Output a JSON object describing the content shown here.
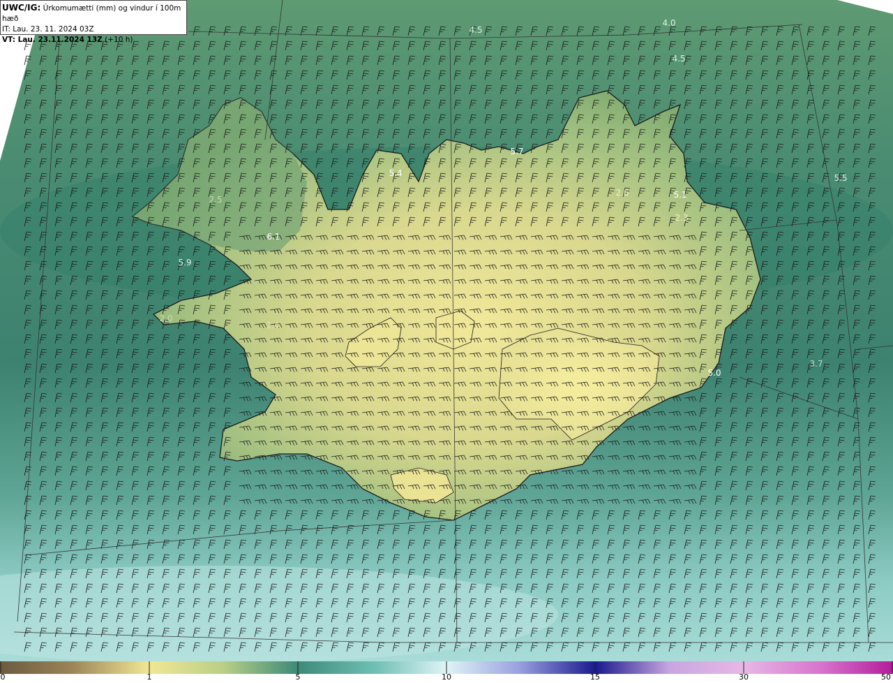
{
  "header": {
    "product": "UWC/IG:",
    "title": "Úrkomumætti (mm) og vindur í 100m hæð",
    "init_time": "IT: Lau. 23. 11. 2024 03Z",
    "valid_prefix": "VT: Lau. 23.11.2024 13Z",
    "valid_suffix": "(+10 h)"
  },
  "colors": {
    "field_sea_dark": "#3f7f6a",
    "field_sea_light": "#9fd6d0",
    "field_land_low": "#7ea86c",
    "field_land_high": "#efe79a",
    "coastline": "#1a1a1a",
    "grid_line": "#333333",
    "wind_barb": "#1a1a1a"
  },
  "map_labels": [
    {
      "text": "4.5",
      "color": "light"
    },
    {
      "text": "4.0",
      "color": "light"
    },
    {
      "text": "4.5",
      "color": "light"
    },
    {
      "text": "5.7",
      "color": "light"
    },
    {
      "text": "5.4",
      "color": "light"
    },
    {
      "text": "5.5",
      "color": "light"
    },
    {
      "text": "2.5",
      "color": "faint"
    },
    {
      "text": "2.6",
      "color": "faint"
    },
    {
      "text": "5.1",
      "color": "light"
    },
    {
      "text": "2.3",
      "color": "faint"
    },
    {
      "text": "6.1",
      "color": "light"
    },
    {
      "text": "5.9",
      "color": "light"
    },
    {
      "text": "2.0",
      "color": "faint"
    },
    {
      "text": "2.4",
      "color": "faint"
    },
    {
      "text": "5.0",
      "color": "light"
    },
    {
      "text": "3.7",
      "color": "faint"
    }
  ],
  "colorbar": {
    "ticks": [
      "0",
      "1",
      "5",
      "10",
      "15",
      "30",
      "50"
    ],
    "colors": [
      "#6b5a3e",
      "#b8a56a",
      "#f2e795",
      "#9fbf78",
      "#3d8a78",
      "#7fcfc6",
      "#dff4f6",
      "#7f86d8",
      "#1a1a8e",
      "#c8a6e0",
      "#d873cc",
      "#b31d9b"
    ]
  }
}
